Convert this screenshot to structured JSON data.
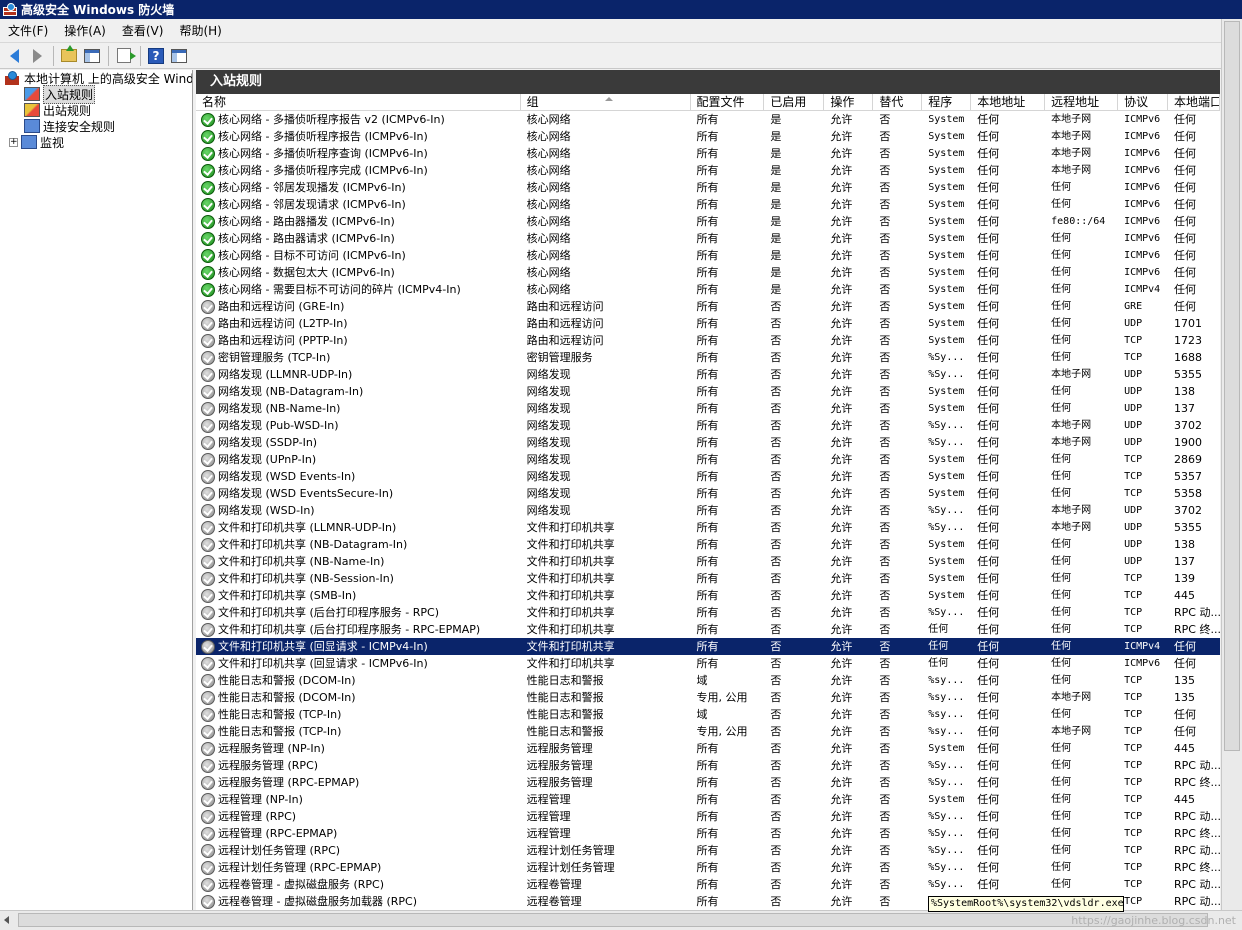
{
  "window": {
    "title": "高级安全 Windows 防火墙"
  },
  "menu": [
    "文件(F)",
    "操作(A)",
    "查看(V)",
    "帮助(H)"
  ],
  "toolbar": {
    "back": "back-arrow-icon",
    "forward": "forward-arrow-icon",
    "up": "up-folder-icon",
    "show_hide": "console-tree-icon",
    "export": "export-list-icon",
    "help": "?",
    "action_pane": "action-pane-icon"
  },
  "tree": {
    "root": "本地计算机 上的高级安全 Windows 防火墙",
    "inbound": "入站规则",
    "outbound": "出站规则",
    "connection_security": "连接安全规则",
    "monitor_expander": "+",
    "monitor": "监视"
  },
  "pane_title": "入站规则",
  "columns": [
    "名称",
    "组",
    "配置文件",
    "已启用",
    "操作",
    "替代",
    "程序",
    "本地地址",
    "远程地址",
    "协议",
    "本地端口"
  ],
  "rows": [
    {
      "enabled": true,
      "name": "核心网络 - 多播侦听程序报告 v2 (ICMPv6-In)",
      "group": "核心网络",
      "profile": "所有",
      "on": "是",
      "action": "允许",
      "override": "否",
      "program": "System",
      "local": "任何",
      "remote": "本地子网",
      "proto": "ICMPv6",
      "port": "任何"
    },
    {
      "enabled": true,
      "name": "核心网络 - 多播侦听程序报告 (ICMPv6-In)",
      "group": "核心网络",
      "profile": "所有",
      "on": "是",
      "action": "允许",
      "override": "否",
      "program": "System",
      "local": "任何",
      "remote": "本地子网",
      "proto": "ICMPv6",
      "port": "任何"
    },
    {
      "enabled": true,
      "name": "核心网络 - 多播侦听程序查询 (ICMPv6-In)",
      "group": "核心网络",
      "profile": "所有",
      "on": "是",
      "action": "允许",
      "override": "否",
      "program": "System",
      "local": "任何",
      "remote": "本地子网",
      "proto": "ICMPv6",
      "port": "任何"
    },
    {
      "enabled": true,
      "name": "核心网络 - 多播侦听程序完成 (ICMPv6-In)",
      "group": "核心网络",
      "profile": "所有",
      "on": "是",
      "action": "允许",
      "override": "否",
      "program": "System",
      "local": "任何",
      "remote": "本地子网",
      "proto": "ICMPv6",
      "port": "任何"
    },
    {
      "enabled": true,
      "name": "核心网络 - 邻居发现播发 (ICMPv6-In)",
      "group": "核心网络",
      "profile": "所有",
      "on": "是",
      "action": "允许",
      "override": "否",
      "program": "System",
      "local": "任何",
      "remote": "任何",
      "proto": "ICMPv6",
      "port": "任何"
    },
    {
      "enabled": true,
      "name": "核心网络 - 邻居发现请求 (ICMPv6-In)",
      "group": "核心网络",
      "profile": "所有",
      "on": "是",
      "action": "允许",
      "override": "否",
      "program": "System",
      "local": "任何",
      "remote": "任何",
      "proto": "ICMPv6",
      "port": "任何"
    },
    {
      "enabled": true,
      "name": "核心网络 - 路由器播发 (ICMPv6-In)",
      "group": "核心网络",
      "profile": "所有",
      "on": "是",
      "action": "允许",
      "override": "否",
      "program": "System",
      "local": "任何",
      "remote": "fe80::/64",
      "proto": "ICMPv6",
      "port": "任何"
    },
    {
      "enabled": true,
      "name": "核心网络 - 路由器请求 (ICMPv6-In)",
      "group": "核心网络",
      "profile": "所有",
      "on": "是",
      "action": "允许",
      "override": "否",
      "program": "System",
      "local": "任何",
      "remote": "任何",
      "proto": "ICMPv6",
      "port": "任何"
    },
    {
      "enabled": true,
      "name": "核心网络 - 目标不可访问 (ICMPv6-In)",
      "group": "核心网络",
      "profile": "所有",
      "on": "是",
      "action": "允许",
      "override": "否",
      "program": "System",
      "local": "任何",
      "remote": "任何",
      "proto": "ICMPv6",
      "port": "任何"
    },
    {
      "enabled": true,
      "name": "核心网络 - 数据包太大 (ICMPv6-In)",
      "group": "核心网络",
      "profile": "所有",
      "on": "是",
      "action": "允许",
      "override": "否",
      "program": "System",
      "local": "任何",
      "remote": "任何",
      "proto": "ICMPv6",
      "port": "任何"
    },
    {
      "enabled": true,
      "name": "核心网络 - 需要目标不可访问的碎片 (ICMPv4-In)",
      "group": "核心网络",
      "profile": "所有",
      "on": "是",
      "action": "允许",
      "override": "否",
      "program": "System",
      "local": "任何",
      "remote": "任何",
      "proto": "ICMPv4",
      "port": "任何"
    },
    {
      "enabled": false,
      "name": "路由和远程访问 (GRE-In)",
      "group": "路由和远程访问",
      "profile": "所有",
      "on": "否",
      "action": "允许",
      "override": "否",
      "program": "System",
      "local": "任何",
      "remote": "任何",
      "proto": "GRE",
      "port": "任何"
    },
    {
      "enabled": false,
      "name": "路由和远程访问 (L2TP-In)",
      "group": "路由和远程访问",
      "profile": "所有",
      "on": "否",
      "action": "允许",
      "override": "否",
      "program": "System",
      "local": "任何",
      "remote": "任何",
      "proto": "UDP",
      "port": "1701"
    },
    {
      "enabled": false,
      "name": "路由和远程访问 (PPTP-In)",
      "group": "路由和远程访问",
      "profile": "所有",
      "on": "否",
      "action": "允许",
      "override": "否",
      "program": "System",
      "local": "任何",
      "remote": "任何",
      "proto": "TCP",
      "port": "1723"
    },
    {
      "enabled": false,
      "name": "密钥管理服务 (TCP-In)",
      "group": "密钥管理服务",
      "profile": "所有",
      "on": "否",
      "action": "允许",
      "override": "否",
      "program": "%Sy...",
      "local": "任何",
      "remote": "任何",
      "proto": "TCP",
      "port": "1688"
    },
    {
      "enabled": false,
      "name": "网络发现 (LLMNR-UDP-In)",
      "group": "网络发现",
      "profile": "所有",
      "on": "否",
      "action": "允许",
      "override": "否",
      "program": "%Sy...",
      "local": "任何",
      "remote": "本地子网",
      "proto": "UDP",
      "port": "5355"
    },
    {
      "enabled": false,
      "name": "网络发现 (NB-Datagram-In)",
      "group": "网络发现",
      "profile": "所有",
      "on": "否",
      "action": "允许",
      "override": "否",
      "program": "System",
      "local": "任何",
      "remote": "任何",
      "proto": "UDP",
      "port": "138"
    },
    {
      "enabled": false,
      "name": "网络发现 (NB-Name-In)",
      "group": "网络发现",
      "profile": "所有",
      "on": "否",
      "action": "允许",
      "override": "否",
      "program": "System",
      "local": "任何",
      "remote": "任何",
      "proto": "UDP",
      "port": "137"
    },
    {
      "enabled": false,
      "name": "网络发现 (Pub-WSD-In)",
      "group": "网络发现",
      "profile": "所有",
      "on": "否",
      "action": "允许",
      "override": "否",
      "program": "%Sy...",
      "local": "任何",
      "remote": "本地子网",
      "proto": "UDP",
      "port": "3702"
    },
    {
      "enabled": false,
      "name": "网络发现 (SSDP-In)",
      "group": "网络发现",
      "profile": "所有",
      "on": "否",
      "action": "允许",
      "override": "否",
      "program": "%Sy...",
      "local": "任何",
      "remote": "本地子网",
      "proto": "UDP",
      "port": "1900"
    },
    {
      "enabled": false,
      "name": "网络发现 (UPnP-In)",
      "group": "网络发现",
      "profile": "所有",
      "on": "否",
      "action": "允许",
      "override": "否",
      "program": "System",
      "local": "任何",
      "remote": "任何",
      "proto": "TCP",
      "port": "2869"
    },
    {
      "enabled": false,
      "name": "网络发现 (WSD Events-In)",
      "group": "网络发现",
      "profile": "所有",
      "on": "否",
      "action": "允许",
      "override": "否",
      "program": "System",
      "local": "任何",
      "remote": "任何",
      "proto": "TCP",
      "port": "5357"
    },
    {
      "enabled": false,
      "name": "网络发现 (WSD EventsSecure-In)",
      "group": "网络发现",
      "profile": "所有",
      "on": "否",
      "action": "允许",
      "override": "否",
      "program": "System",
      "local": "任何",
      "remote": "任何",
      "proto": "TCP",
      "port": "5358"
    },
    {
      "enabled": false,
      "name": "网络发现 (WSD-In)",
      "group": "网络发现",
      "profile": "所有",
      "on": "否",
      "action": "允许",
      "override": "否",
      "program": "%Sy...",
      "local": "任何",
      "remote": "本地子网",
      "proto": "UDP",
      "port": "3702"
    },
    {
      "enabled": false,
      "name": "文件和打印机共享 (LLMNR-UDP-In)",
      "group": "文件和打印机共享",
      "profile": "所有",
      "on": "否",
      "action": "允许",
      "override": "否",
      "program": "%Sy...",
      "local": "任何",
      "remote": "本地子网",
      "proto": "UDP",
      "port": "5355"
    },
    {
      "enabled": false,
      "name": "文件和打印机共享 (NB-Datagram-In)",
      "group": "文件和打印机共享",
      "profile": "所有",
      "on": "否",
      "action": "允许",
      "override": "否",
      "program": "System",
      "local": "任何",
      "remote": "任何",
      "proto": "UDP",
      "port": "138"
    },
    {
      "enabled": false,
      "name": "文件和打印机共享 (NB-Name-In)",
      "group": "文件和打印机共享",
      "profile": "所有",
      "on": "否",
      "action": "允许",
      "override": "否",
      "program": "System",
      "local": "任何",
      "remote": "任何",
      "proto": "UDP",
      "port": "137"
    },
    {
      "enabled": false,
      "name": "文件和打印机共享 (NB-Session-In)",
      "group": "文件和打印机共享",
      "profile": "所有",
      "on": "否",
      "action": "允许",
      "override": "否",
      "program": "System",
      "local": "任何",
      "remote": "任何",
      "proto": "TCP",
      "port": "139"
    },
    {
      "enabled": false,
      "name": "文件和打印机共享 (SMB-In)",
      "group": "文件和打印机共享",
      "profile": "所有",
      "on": "否",
      "action": "允许",
      "override": "否",
      "program": "System",
      "local": "任何",
      "remote": "任何",
      "proto": "TCP",
      "port": "445"
    },
    {
      "enabled": false,
      "name": "文件和打印机共享 (后台打印程序服务 - RPC)",
      "group": "文件和打印机共享",
      "profile": "所有",
      "on": "否",
      "action": "允许",
      "override": "否",
      "program": "%Sy...",
      "local": "任何",
      "remote": "任何",
      "proto": "TCP",
      "port": "RPC 动..."
    },
    {
      "enabled": false,
      "name": "文件和打印机共享 (后台打印程序服务 - RPC-EPMAP)",
      "group": "文件和打印机共享",
      "profile": "所有",
      "on": "否",
      "action": "允许",
      "override": "否",
      "program": "任何",
      "local": "任何",
      "remote": "任何",
      "proto": "TCP",
      "port": "RPC 终..."
    },
    {
      "enabled": false,
      "selected": true,
      "name": "文件和打印机共享 (回显请求 - ICMPv4-In)",
      "group": "文件和打印机共享",
      "profile": "所有",
      "on": "否",
      "action": "允许",
      "override": "否",
      "program": "任何",
      "local": "任何",
      "remote": "任何",
      "proto": "ICMPv4",
      "port": "任何"
    },
    {
      "enabled": false,
      "name": "文件和打印机共享 (回显请求 - ICMPv6-In)",
      "group": "文件和打印机共享",
      "profile": "所有",
      "on": "否",
      "action": "允许",
      "override": "否",
      "program": "任何",
      "local": "任何",
      "remote": "任何",
      "proto": "ICMPv6",
      "port": "任何"
    },
    {
      "enabled": false,
      "name": "性能日志和警报 (DCOM-In)",
      "group": "性能日志和警报",
      "profile": "域",
      "on": "否",
      "action": "允许",
      "override": "否",
      "program": "%sy...",
      "local": "任何",
      "remote": "任何",
      "proto": "TCP",
      "port": "135"
    },
    {
      "enabled": false,
      "name": "性能日志和警报 (DCOM-In)",
      "group": "性能日志和警报",
      "profile": "专用, 公用",
      "on": "否",
      "action": "允许",
      "override": "否",
      "program": "%sy...",
      "local": "任何",
      "remote": "本地子网",
      "proto": "TCP",
      "port": "135"
    },
    {
      "enabled": false,
      "name": "性能日志和警报 (TCP-In)",
      "group": "性能日志和警报",
      "profile": "域",
      "on": "否",
      "action": "允许",
      "override": "否",
      "program": "%sy...",
      "local": "任何",
      "remote": "任何",
      "proto": "TCP",
      "port": "任何"
    },
    {
      "enabled": false,
      "name": "性能日志和警报 (TCP-In)",
      "group": "性能日志和警报",
      "profile": "专用, 公用",
      "on": "否",
      "action": "允许",
      "override": "否",
      "program": "%sy...",
      "local": "任何",
      "remote": "本地子网",
      "proto": "TCP",
      "port": "任何"
    },
    {
      "enabled": false,
      "name": "远程服务管理 (NP-In)",
      "group": "远程服务管理",
      "profile": "所有",
      "on": "否",
      "action": "允许",
      "override": "否",
      "program": "System",
      "local": "任何",
      "remote": "任何",
      "proto": "TCP",
      "port": "445"
    },
    {
      "enabled": false,
      "name": "远程服务管理 (RPC)",
      "group": "远程服务管理",
      "profile": "所有",
      "on": "否",
      "action": "允许",
      "override": "否",
      "program": "%Sy...",
      "local": "任何",
      "remote": "任何",
      "proto": "TCP",
      "port": "RPC 动..."
    },
    {
      "enabled": false,
      "name": "远程服务管理 (RPC-EPMAP)",
      "group": "远程服务管理",
      "profile": "所有",
      "on": "否",
      "action": "允许",
      "override": "否",
      "program": "%Sy...",
      "local": "任何",
      "remote": "任何",
      "proto": "TCP",
      "port": "RPC 终..."
    },
    {
      "enabled": false,
      "name": "远程管理 (NP-In)",
      "group": "远程管理",
      "profile": "所有",
      "on": "否",
      "action": "允许",
      "override": "否",
      "program": "System",
      "local": "任何",
      "remote": "任何",
      "proto": "TCP",
      "port": "445"
    },
    {
      "enabled": false,
      "name": "远程管理 (RPC)",
      "group": "远程管理",
      "profile": "所有",
      "on": "否",
      "action": "允许",
      "override": "否",
      "program": "%Sy...",
      "local": "任何",
      "remote": "任何",
      "proto": "TCP",
      "port": "RPC 动..."
    },
    {
      "enabled": false,
      "name": "远程管理 (RPC-EPMAP)",
      "group": "远程管理",
      "profile": "所有",
      "on": "否",
      "action": "允许",
      "override": "否",
      "program": "%Sy...",
      "local": "任何",
      "remote": "任何",
      "proto": "TCP",
      "port": "RPC 终..."
    },
    {
      "enabled": false,
      "name": "远程计划任务管理 (RPC)",
      "group": "远程计划任务管理",
      "profile": "所有",
      "on": "否",
      "action": "允许",
      "override": "否",
      "program": "%Sy...",
      "local": "任何",
      "remote": "任何",
      "proto": "TCP",
      "port": "RPC 动..."
    },
    {
      "enabled": false,
      "name": "远程计划任务管理 (RPC-EPMAP)",
      "group": "远程计划任务管理",
      "profile": "所有",
      "on": "否",
      "action": "允许",
      "override": "否",
      "program": "%Sy...",
      "local": "任何",
      "remote": "任何",
      "proto": "TCP",
      "port": "RPC 终..."
    },
    {
      "enabled": false,
      "name": "远程卷管理 - 虚拟磁盘服务 (RPC)",
      "group": "远程卷管理",
      "profile": "所有",
      "on": "否",
      "action": "允许",
      "override": "否",
      "program": "%Sy...",
      "local": "任何",
      "remote": "任何",
      "proto": "TCP",
      "port": "RPC 动..."
    },
    {
      "enabled": false,
      "name": "远程卷管理 - 虚拟磁盘服务加载器 (RPC)",
      "group": "远程卷管理",
      "profile": "所有",
      "on": "否",
      "action": "允许",
      "override": "否",
      "program": "",
      "local": "",
      "remote": "",
      "proto": "TCP",
      "port": "RPC 动..."
    }
  ],
  "tooltip": "%SystemRoot%\\system32\\vdsldr.exe",
  "watermark": "https://gaojinhe.blog.csdn.net"
}
